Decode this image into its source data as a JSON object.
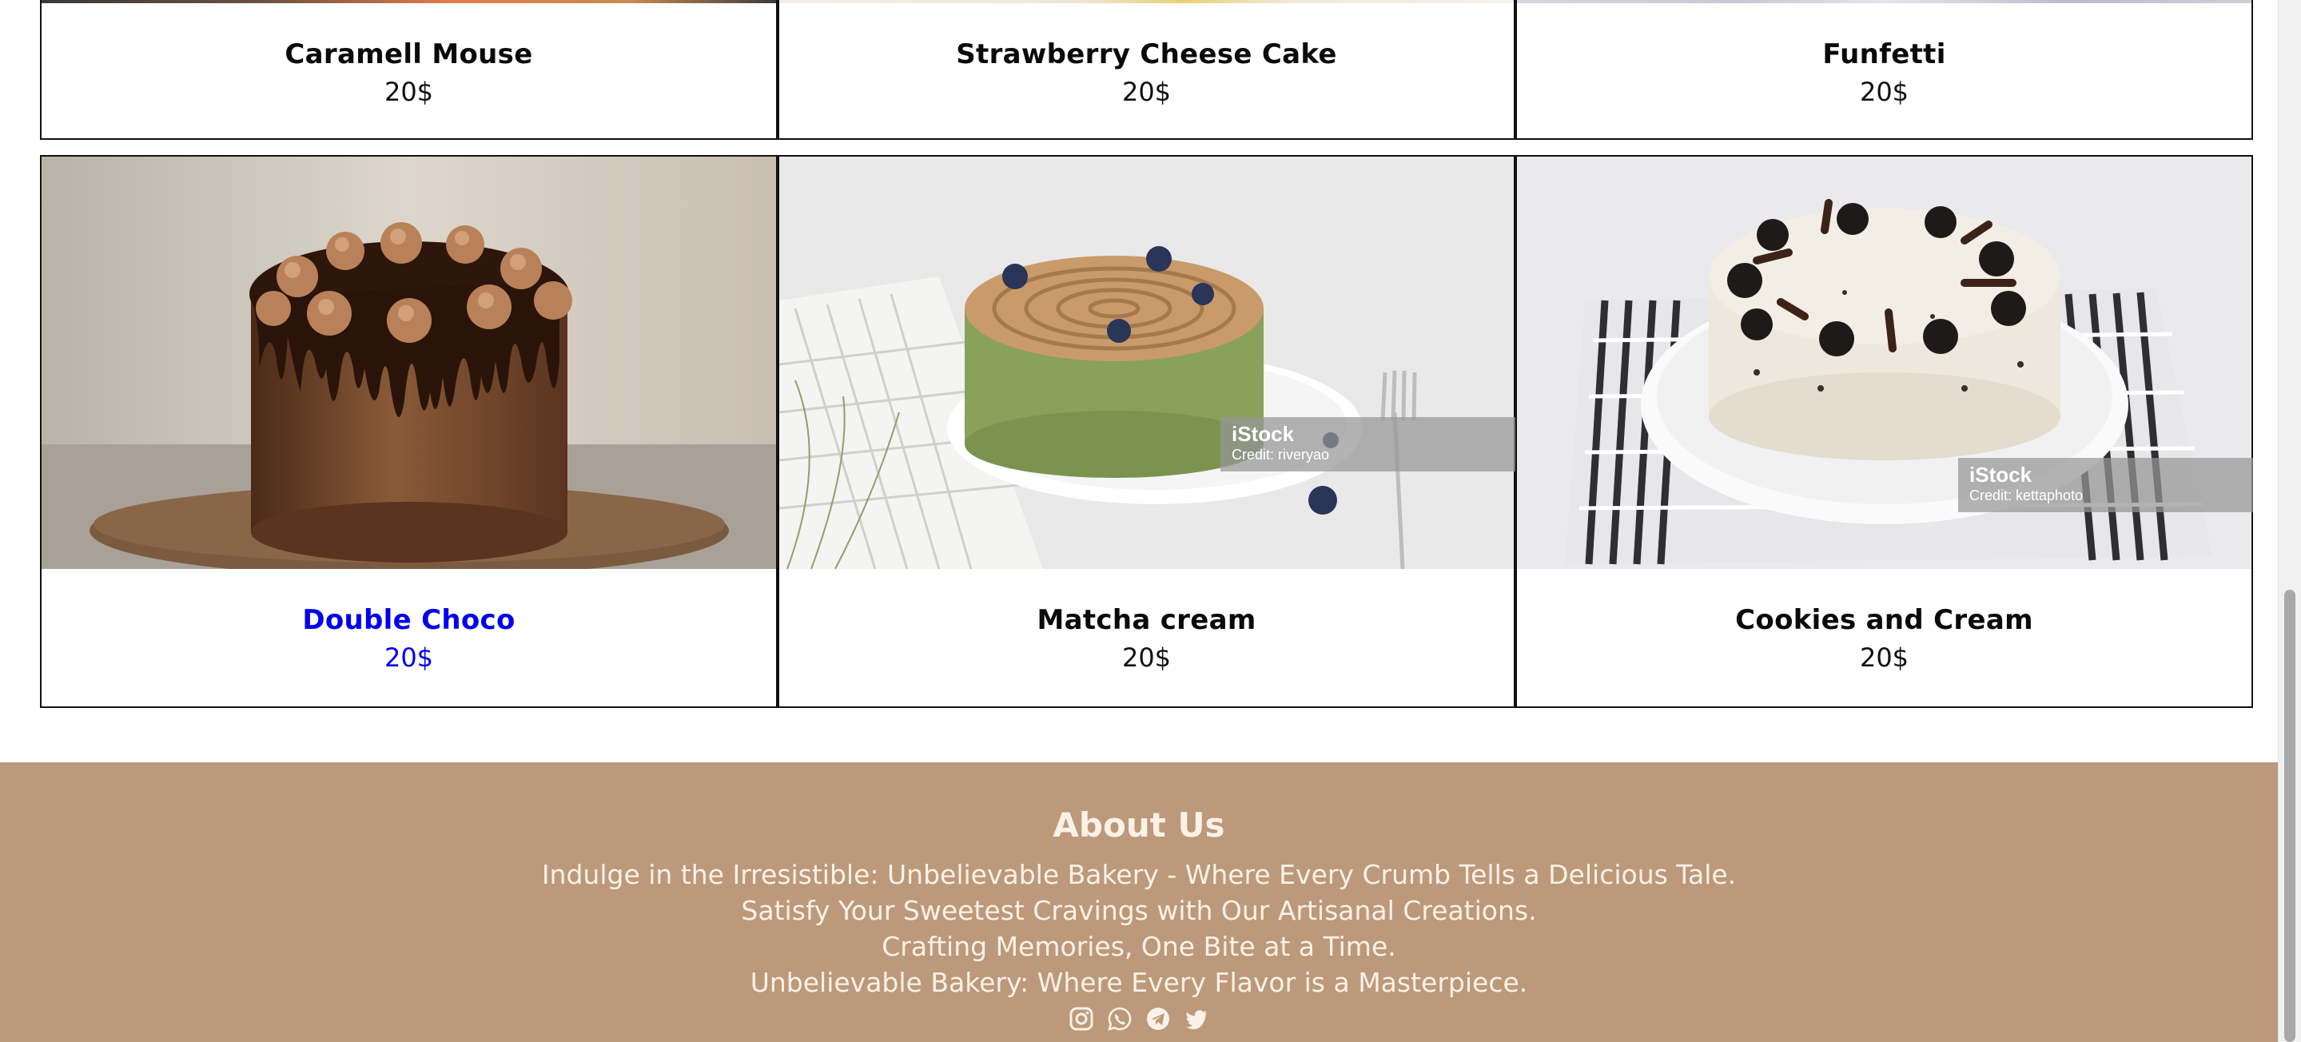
{
  "products_top": [
    {
      "name": "Caramell Mouse",
      "price": "20$"
    },
    {
      "name": "Strawberry Cheese Cake",
      "price": "20$"
    },
    {
      "name": "Funfetti",
      "price": "20$"
    }
  ],
  "products_bottom": [
    {
      "name": "Double Choco",
      "price": "20$",
      "image": "chocolate-drip-cake"
    },
    {
      "name": "Matcha cream",
      "price": "20$",
      "image": "matcha-cake",
      "watermark": {
        "brand": "iStock",
        "credit": "Credit: riveryao"
      }
    },
    {
      "name": "Cookies and Cream",
      "price": "20$",
      "image": "cookies-cream-cake",
      "watermark": {
        "brand": "iStock",
        "credit": "Credit: kettaphoto"
      }
    }
  ],
  "footer": {
    "title": "About Us",
    "lines": [
      "Indulge in the Irresistible: Unbelievable Bakery - Where Every Crumb Tells a Delicious Tale.",
      "Satisfy Your Sweetest Cravings with Our Artisanal Creations.",
      "Crafting Memories, One Bite at a Time.",
      "Unbelievable Bakery: Where Every Flavor is a Masterpiece."
    ],
    "socials": [
      "instagram-icon",
      "whatsapp-icon",
      "telegram-icon",
      "twitter-icon"
    ]
  },
  "colors": {
    "footer_bg": "#bc997b",
    "footer_text": "#fbf1e6",
    "link_active": "#0000ee",
    "card_border": "#111111"
  }
}
